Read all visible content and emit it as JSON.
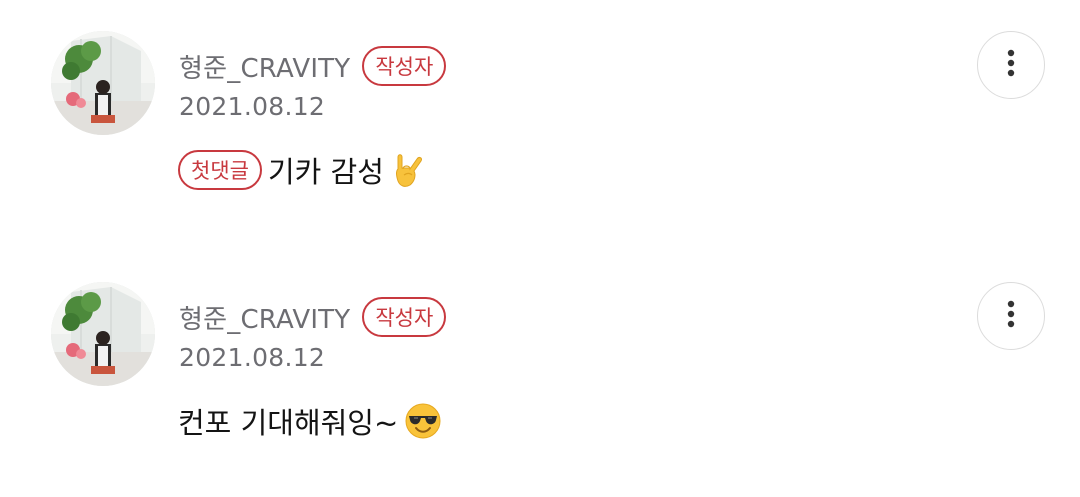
{
  "comments": [
    {
      "author": "형준_CRAVITY",
      "author_badge": "작성자",
      "date": "2021.08.12",
      "first_comment_badge": "첫댓글",
      "text": "기카 감성",
      "emoji": "sign-of-the-horns-emoji",
      "more_icon": "more-vertical-icon"
    },
    {
      "author": "형준_CRAVITY",
      "author_badge": "작성자",
      "date": "2021.08.12",
      "text": "컨포 기대해줘잉~",
      "emoji": "smiling-face-with-sunglasses-emoji",
      "more_icon": "more-vertical-icon"
    }
  ],
  "colors": {
    "badge": "#c8393f",
    "meta_text": "#6d6d72",
    "body_text": "#141414",
    "button_border": "#dcdcdc"
  }
}
